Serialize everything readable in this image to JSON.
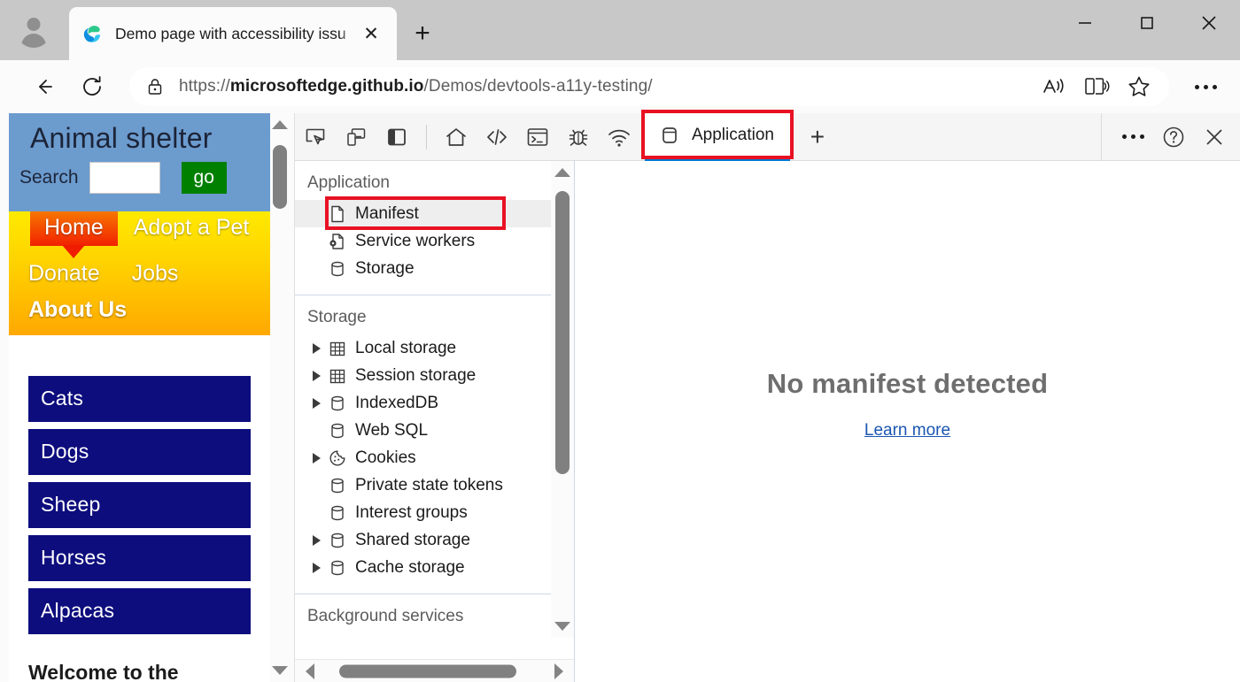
{
  "browser": {
    "tab": {
      "title": "Demo page with accessibility issu",
      "favicon": "edge-logo-icon",
      "close_label": "✕"
    },
    "new_tab_label": "+",
    "window_controls": {
      "minimize": "minimize-icon",
      "maximize": "maximize-icon",
      "close": "close-icon"
    },
    "nav": {
      "back": "back-arrow-icon",
      "refresh": "refresh-icon"
    },
    "address_bar": {
      "lock": "lock-icon",
      "url_scheme": "https://",
      "url_domain": "microsoftedge.github.io",
      "url_path": "/Demos/devtools-a11y-testing/",
      "full_url": "https://microsoftedge.github.io/Demos/devtools-a11y-testing/"
    },
    "omnibox_actions": [
      {
        "name": "read-aloud-icon"
      },
      {
        "name": "immersive-reader-icon"
      },
      {
        "name": "favorites-star-icon"
      }
    ],
    "settings_more": "more-options-icon"
  },
  "page": {
    "site_title": "Animal shelter",
    "search": {
      "label": "Search",
      "value": "",
      "placeholder": "",
      "button_label": "go"
    },
    "nav_links": {
      "home": "Home",
      "adopt": "Adopt a Pet",
      "donate": "Donate",
      "jobs": "Jobs",
      "about": "About Us"
    },
    "categories": [
      "Cats",
      "Dogs",
      "Sheep",
      "Horses",
      "Alpacas"
    ],
    "teaser": "Welcome to the",
    "colors": {
      "header_bg": "#6c9bce",
      "nav_gradient_top": "#ffea00",
      "nav_gradient_bottom": "#ffa800",
      "home_tab_top": "#f77600",
      "home_tab_bottom": "#f22100",
      "category_bg": "#0d0d7e",
      "go_button_bg": "#008000"
    }
  },
  "devtools": {
    "toolbar_icons": [
      {
        "name": "inspect-element-icon"
      },
      {
        "name": "device-emulation-icon"
      },
      {
        "name": "dock-side-icon"
      }
    ],
    "panel_icons": [
      {
        "name": "home-icon"
      },
      {
        "name": "elements-code-icon"
      },
      {
        "name": "console-icon"
      },
      {
        "name": "debugger-bug-icon"
      },
      {
        "name": "network-wifi-icon"
      }
    ],
    "active_tab": {
      "label": "Application",
      "icon": "application-icon",
      "highlight_color": "#e81123",
      "accent_color": "#0078d4"
    },
    "add_tab_label": "+",
    "right_actions": [
      {
        "name": "more-tools-icon"
      },
      {
        "name": "help-icon"
      },
      {
        "name": "close-devtools-icon"
      }
    ],
    "sidebar": {
      "sections": [
        {
          "title": "Application",
          "items": [
            {
              "label": "Manifest",
              "icon": "document-icon",
              "twisty": false,
              "selected": true,
              "highlighted": true
            },
            {
              "label": "Service workers",
              "icon": "service-worker-icon",
              "twisty": false,
              "selected": false,
              "highlighted": false
            },
            {
              "label": "Storage",
              "icon": "database-icon",
              "twisty": false,
              "selected": false,
              "highlighted": false
            }
          ]
        },
        {
          "title": "Storage",
          "items": [
            {
              "label": "Local storage",
              "icon": "table-grid-icon",
              "twisty": true,
              "selected": false,
              "highlighted": false
            },
            {
              "label": "Session storage",
              "icon": "table-grid-icon",
              "twisty": true,
              "selected": false,
              "highlighted": false
            },
            {
              "label": "IndexedDB",
              "icon": "database-icon",
              "twisty": true,
              "selected": false,
              "highlighted": false
            },
            {
              "label": "Web SQL",
              "icon": "database-icon",
              "twisty": false,
              "selected": false,
              "highlighted": false
            },
            {
              "label": "Cookies",
              "icon": "cookie-icon",
              "twisty": true,
              "selected": false,
              "highlighted": false
            },
            {
              "label": "Private state tokens",
              "icon": "database-icon",
              "twisty": false,
              "selected": false,
              "highlighted": false
            },
            {
              "label": "Interest groups",
              "icon": "database-icon",
              "twisty": false,
              "selected": false,
              "highlighted": false
            },
            {
              "label": "Shared storage",
              "icon": "database-icon",
              "twisty": true,
              "selected": false,
              "highlighted": false
            },
            {
              "label": "Cache storage",
              "icon": "database-icon",
              "twisty": true,
              "selected": false,
              "highlighted": false
            }
          ]
        },
        {
          "title": "Background services",
          "items": []
        }
      ]
    },
    "main_panel": {
      "empty_title": "No manifest detected",
      "learn_more": "Learn more"
    }
  }
}
